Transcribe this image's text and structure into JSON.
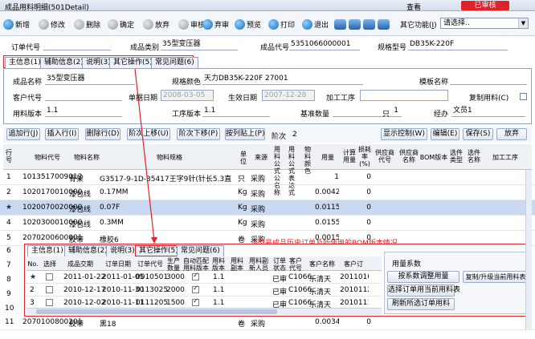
{
  "window": {
    "title": "成品用料明细(501Detail)",
    "view_label": "查看",
    "status_badge": "已审核"
  },
  "toolbar": {
    "buttons": [
      "新增",
      "修改",
      "删除",
      "确定",
      "放弃",
      "审核",
      "弃审",
      "预览",
      "打印",
      "退出"
    ],
    "nav_icons": [
      "first-icon",
      "prev-icon",
      "next-icon",
      "last-icon"
    ],
    "other_func_label": "其它功能(",
    "other_func_key": "I",
    "other_func_close": ")",
    "other_func_value": "请选择.."
  },
  "header": {
    "order_no_label": "订单代号",
    "category_label": "成品类别",
    "category_value": "35型变压器",
    "product_code_label": "成品代号",
    "product_code_value": "5351066000001",
    "model_label": "规格型号",
    "model_value": "DB35K-220F"
  },
  "main_tabs": [
    "主信息(1)",
    "辅助信息(2)",
    "说明(3)",
    "其它操作(5)",
    "常见问题(6)"
  ],
  "main_info": {
    "name_label": "成品名称",
    "name_value": "35型变压器",
    "spec_label": "规格颜色",
    "spec_value": "天力DB35K-220F 27001",
    "mold_label": "模板名称",
    "customer_label": "客户代号",
    "date_label": "单据日期",
    "date_value": "2008-03-05",
    "effective_label": "生效日期",
    "effective_value": "2007-12-28",
    "process_label": "加工工序",
    "copy_label": "复制用料(C)",
    "version_label": "用料版本",
    "version_value": "1.1",
    "process_ver_label": "工序版本",
    "process_ver_value": "1.1",
    "base_qty_label": "基准数量",
    "base_qty_value": "1",
    "base_qty_unit": "只",
    "handler_label": "经办",
    "handler_value": "文员1"
  },
  "grid_toolbar": {
    "buttons": [
      "追加行(J)",
      "插入行(I)",
      "删除行(D)",
      "阶次上移(U)",
      "阶次下移(P)",
      "按列贴上(P)"
    ],
    "level_label": "阶次",
    "level_value": "2",
    "right_buttons": [
      "显示控制(W)",
      "编辑(E)",
      "保存(S)",
      "放弃"
    ]
  },
  "grid": {
    "columns": [
      "行号",
      "物料代号",
      "物料名称",
      "物料规格",
      "单位",
      "来源",
      "用料公式公名称",
      "用料公式表达式",
      "物料颜色",
      "用量",
      "计算用量",
      "损耗率(%)",
      "供应商代号",
      "供应商名称",
      "BOM版本",
      "选件类型",
      "选件名称",
      "加工工序"
    ],
    "rows": [
      {
        "no": "1",
        "code": "1013517009012",
        "name": "骨架",
        "spec": "G3517-9-1D-35417王字9针(针长5.3直径1.0)",
        "unit": "只",
        "source": "采购",
        "qty": "1",
        "loss": "0"
      },
      {
        "no": "2",
        "code": "1020170010000",
        "name": "漆包线",
        "spec": "0.17MM",
        "unit": "Kg",
        "source": "采购",
        "qty": "0.0042",
        "loss": "0"
      },
      {
        "no": "★",
        "code": "1020070020000",
        "name": "漆包线",
        "spec": "0.07F",
        "unit": "Kg",
        "source": "采购",
        "qty": "0.0115",
        "loss": "0"
      },
      {
        "no": "4",
        "code": "1020300010000",
        "name": "漆包线",
        "spec": "0.3MM",
        "unit": "Kg",
        "source": "采购",
        "qty": "0.0155",
        "loss": "0"
      },
      {
        "no": "5",
        "code": "2070200600001",
        "name": "胶带",
        "spec": "橡胶6",
        "unit": "卷",
        "source": "采购",
        "qty": "0.0015",
        "loss": "0"
      }
    ],
    "partial_rows": [
      {
        "no": "6"
      },
      {
        "no": "7"
      },
      {
        "no": "8"
      },
      {
        "no": "9"
      },
      {
        "no": "10"
      },
      {
        "no": "11",
        "code": "2070100800201",
        "name": "胶带",
        "spec": "黑18",
        "unit": "卷",
        "source": "采购",
        "qty": "0.0034",
        "loss": "0"
      }
    ]
  },
  "annotation": "该型号成品历史订单及所使用的BOM版本情况",
  "popup": {
    "tabs": [
      "主信息(1)",
      "辅助信息(2)",
      "说明(3)",
      "其它操作(5)",
      "常见问题(6)"
    ],
    "columns": [
      "No.",
      "选择",
      "成品交期",
      "订单日期",
      "订单代号",
      "生产数量",
      "自动匹配用料版本",
      "用料版本",
      "用料副本",
      "用料副新人员",
      "订单状态",
      "客户代号",
      "客户名称",
      "客户订"
    ],
    "rows": [
      {
        "no": "★",
        "checked": false,
        "delivery": "2011-01-22",
        "order_date": "2011-01-05",
        "order_no": "0010501",
        "qty": "3000",
        "auto": true,
        "ver": "1.1",
        "status": "已审",
        "cust": "C1066",
        "cust_name": "乐清天",
        "cust_order": "20110104"
      },
      {
        "no": "2",
        "checked": false,
        "delivery": "2010-12-17",
        "order_date": "2010-11-30",
        "order_no": "0113025",
        "qty": "2000",
        "auto": true,
        "ver": "1.1",
        "status": "已审",
        "cust": "C1066",
        "cust_name": "乐清天",
        "cust_order": "20101126"
      },
      {
        "no": "3",
        "checked": false,
        "delivery": "2010-12-02",
        "order_date": "2010-11-11",
        "order_no": "0111205",
        "qty": "1500",
        "auto": true,
        "ver": "1.1",
        "status": "已审",
        "cust": "C1066",
        "cust_name": "乐清天",
        "cust_order": "20101110"
      }
    ],
    "side": {
      "title": "用量系数",
      "buttons": [
        "按系数调整用量",
        "复制/升级当前用料表",
        "选择订单用当前用料表",
        "刷新所选订单用料"
      ]
    }
  }
}
